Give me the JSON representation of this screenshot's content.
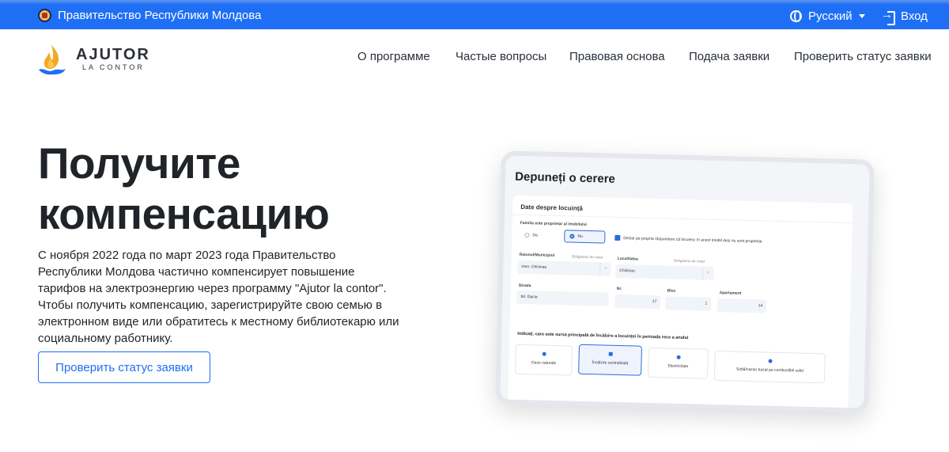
{
  "colors": {
    "brand_blue": "#1e6ff5",
    "text_dark": "#202428"
  },
  "topbar": {
    "government": "Правительство Республики Молдова",
    "language": "Русский",
    "login": "Вход",
    "icons": [
      "coat-of-arms-icon",
      "globe-icon",
      "chevron-down-icon",
      "login-icon"
    ]
  },
  "logo": {
    "title": "AJUTOR",
    "subtitle": "LA CONTOR"
  },
  "nav": {
    "items": [
      {
        "label": "О программе"
      },
      {
        "label": "Частые вопросы"
      },
      {
        "label": "Правовая основа"
      },
      {
        "label": "Подача заявки"
      },
      {
        "label": "Проверить статус заявки"
      }
    ]
  },
  "hero": {
    "title_line1": "Получите",
    "title_line2": "компенсацию",
    "text": "С ноября 2022 года по март 2023 года Правительство Республики Молдова частично компенсирует повышение тарифов на электроэнергию через программу \"Ajutor la contor\". Чтобы получить компенсацию, зарегистрируйте свою семью в электронном виде или обратитесь к местному библиотекарю или социальному работнику.",
    "button": "Проверить статус заявки"
  },
  "tablet": {
    "title": "Depuneți o cerere",
    "section": "Date despre locuință",
    "owner_label": "Familia este proprietar al imobilului",
    "yes": "Da",
    "no": "Nu",
    "declaration": "Declar pe propria răspundere că locuiesc în acest imobil deși nu sunt proprietar",
    "raion_label": "Raionul/Municipiul",
    "required": "Obligatoriu de notat",
    "raion_value": "mun. Chisinau",
    "loc_label": "Localitatea",
    "loc_value": "Chisinau",
    "street_label": "Strada",
    "street_value": "bd. Dacia",
    "nr_label": "Nr.",
    "nr_value": "17",
    "bloc_label": "Bloc",
    "bloc_value": "1",
    "apt_label": "Apartament",
    "apt_value": "14",
    "question": "Indicați, care este sursa principală de încălzire a locuinței în perioada rece a anului",
    "options": [
      "Gaze naturale",
      "Încălzire centralizată",
      "Electricitate",
      "Sobă/cazan bazat pe combustibil solid"
    ]
  }
}
